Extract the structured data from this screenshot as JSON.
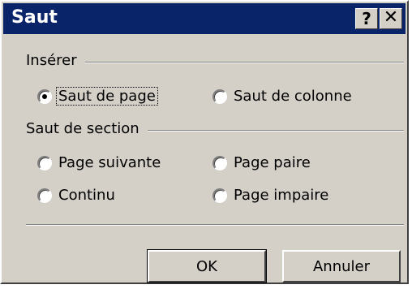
{
  "window": {
    "title": "Saut",
    "help_glyph": "?",
    "close_glyph": "✕"
  },
  "insert_group": {
    "label": "Insérer",
    "options": [
      {
        "label": "Saut de page",
        "checked": true
      },
      {
        "label": "Saut de colonne",
        "checked": false
      }
    ]
  },
  "section_group": {
    "label": "Saut de section",
    "options": [
      {
        "label": "Page suivante",
        "checked": false
      },
      {
        "label": "Page paire",
        "checked": false
      },
      {
        "label": "Continu",
        "checked": false
      },
      {
        "label": "Page impaire",
        "checked": false
      }
    ]
  },
  "buttons": {
    "ok": "OK",
    "cancel": "Annuler"
  },
  "icons": {
    "help": "help-icon",
    "close": "close-icon"
  }
}
